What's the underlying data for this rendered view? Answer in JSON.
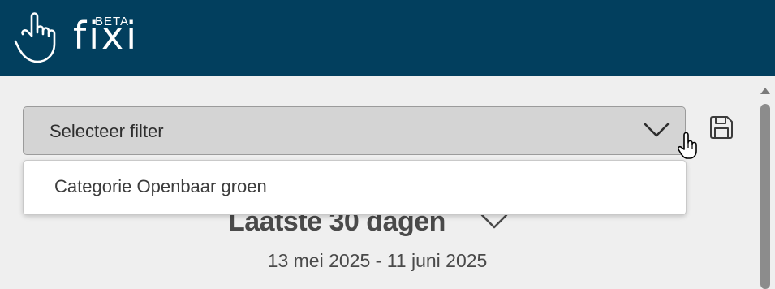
{
  "app": {
    "logo_text": "fixi",
    "badge": "BETA"
  },
  "filter": {
    "placeholder": "Selecteer filter",
    "options": [
      "Categorie Openbaar groen"
    ]
  },
  "period": {
    "label": "Laatste 30 dagen",
    "range": "13 mei 2025 - 11 juni 2025"
  },
  "colors": {
    "header_bg": "#023f5e",
    "page_bg": "#efefef",
    "select_bg": "#d4d4d4"
  },
  "icons": {
    "logo": "hand-pointer-icon",
    "select_toggle": "chevron-down-icon",
    "save": "save-icon",
    "period_toggle": "chevron-down-icon",
    "cursor": "hand-cursor-icon"
  }
}
